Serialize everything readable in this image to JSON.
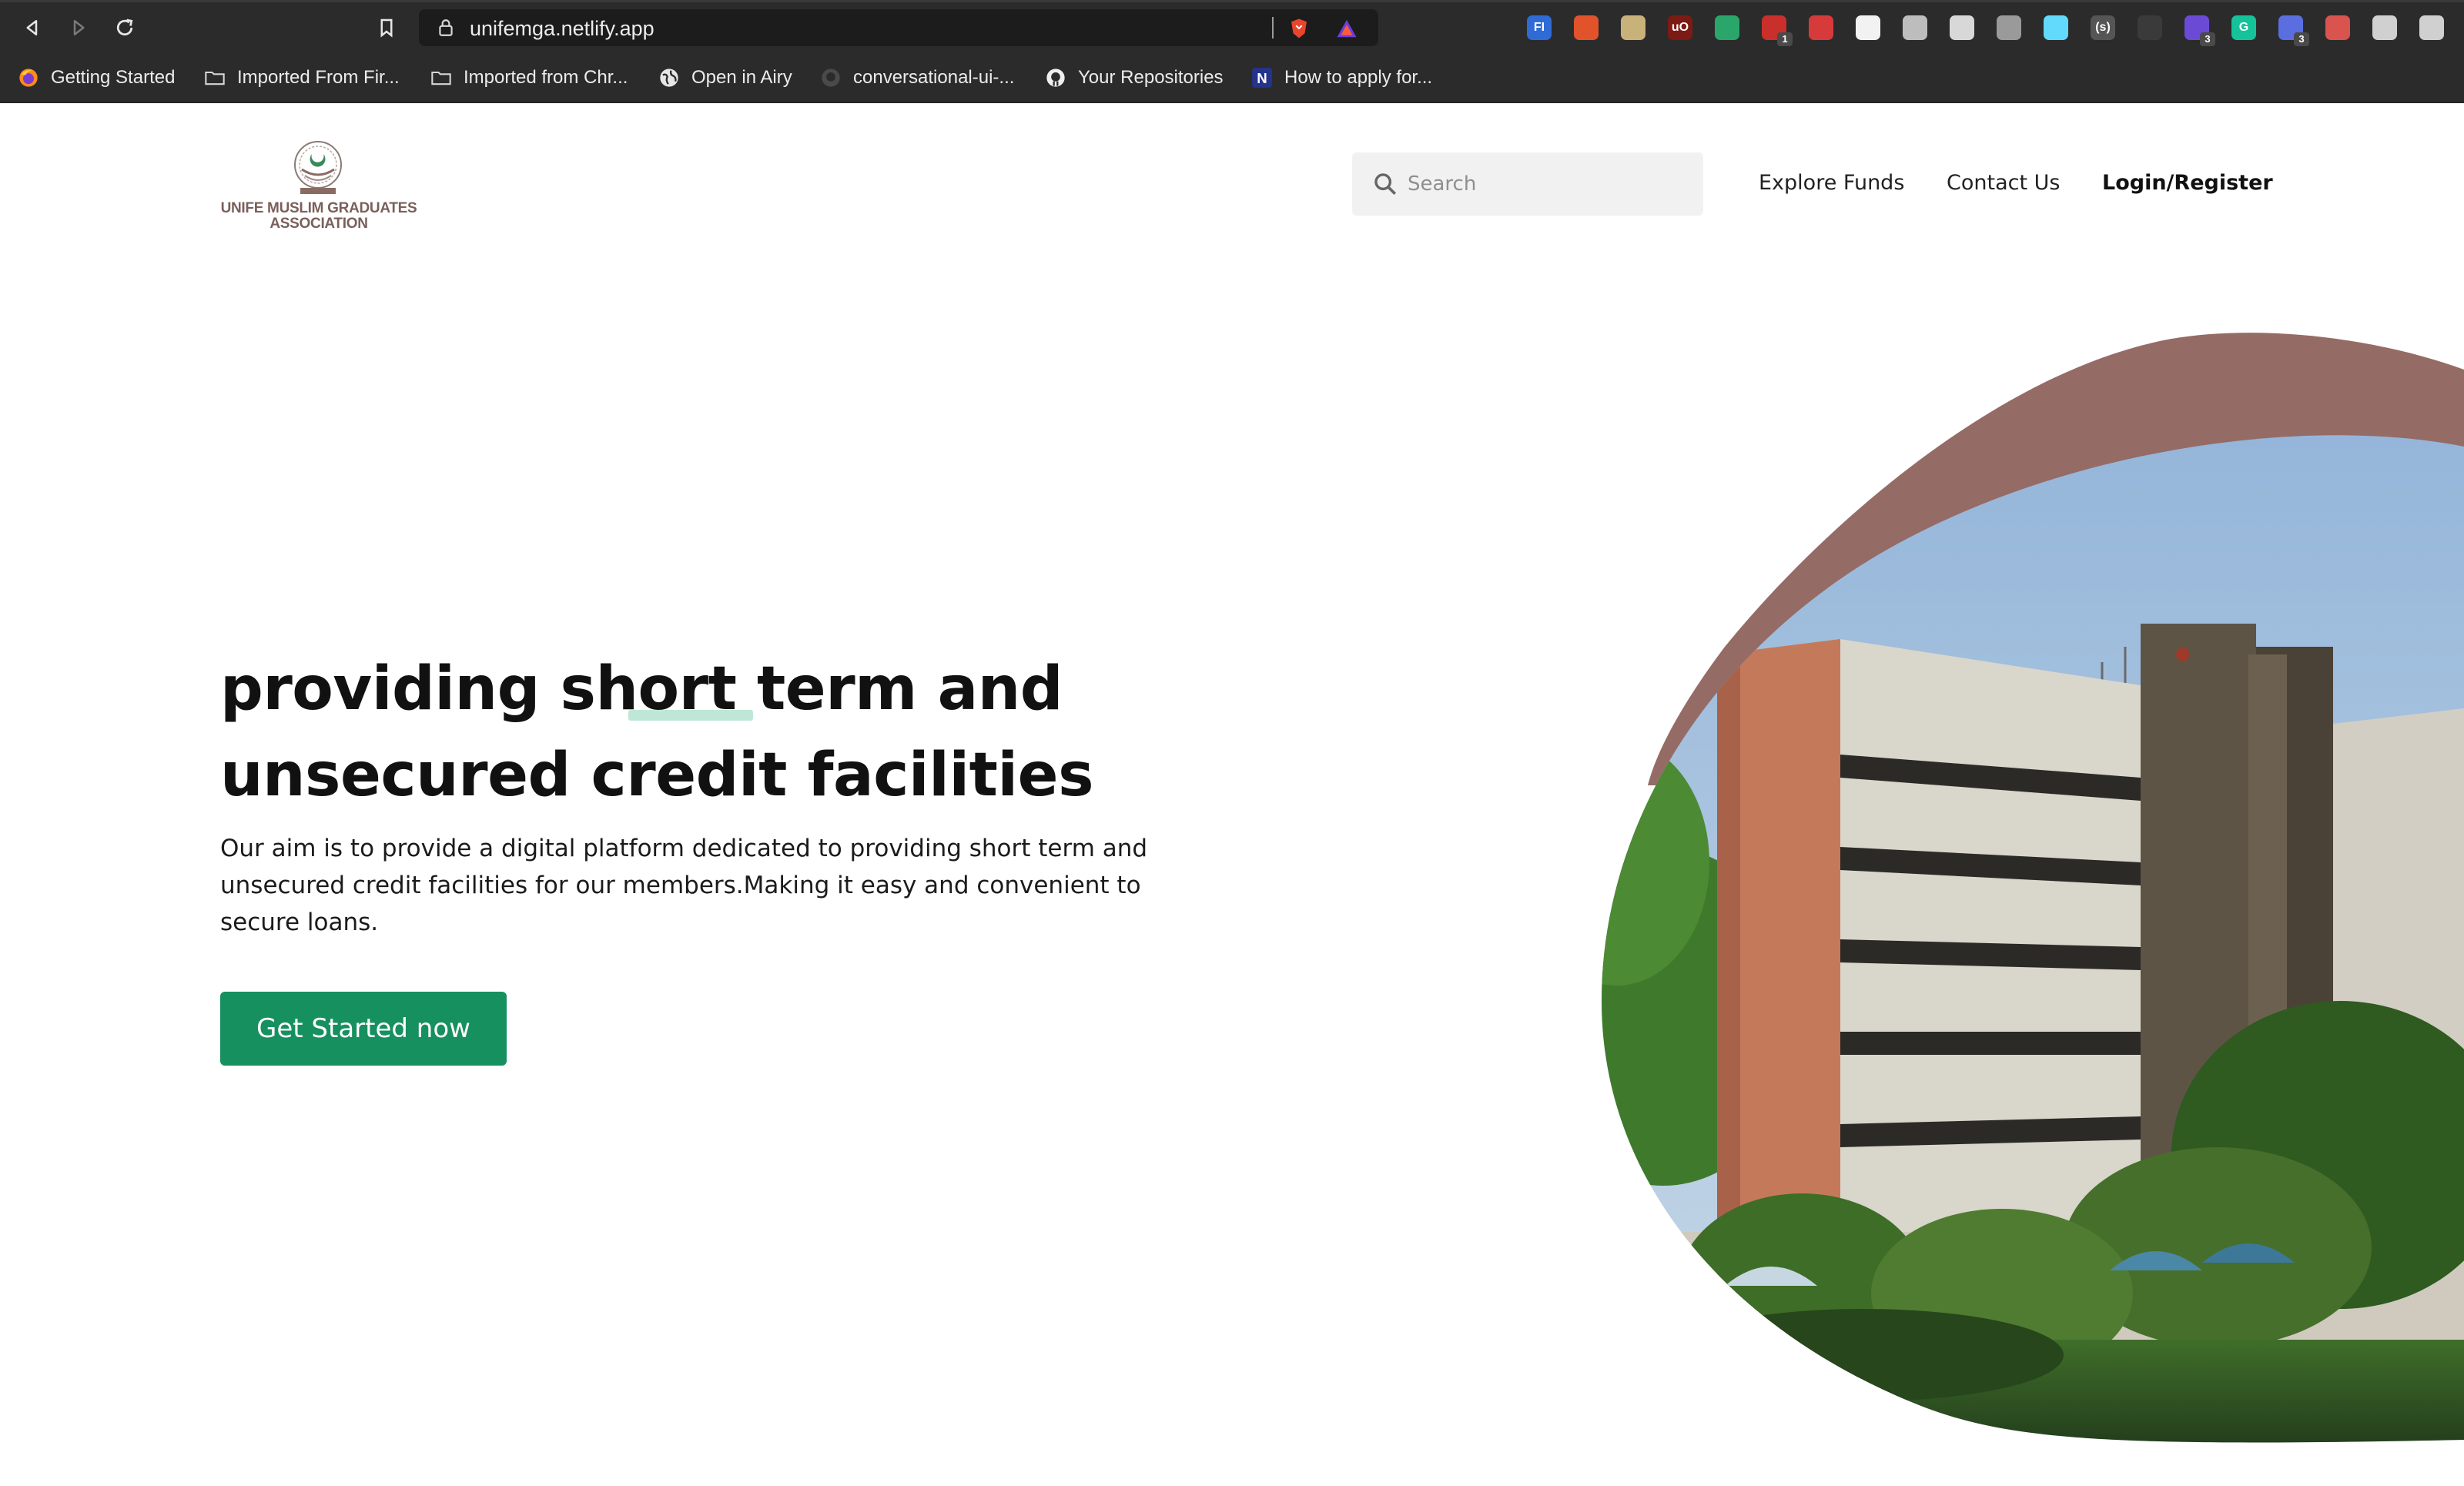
{
  "browser": {
    "url": "unifemga.netlify.app",
    "extensions": [
      {
        "name": "fl-icon",
        "label": "FI",
        "color": "#2e6bd6"
      },
      {
        "name": "flame-icon",
        "label": "",
        "color": "#e0532b"
      },
      {
        "name": "robot-icon",
        "label": "",
        "color": "#c9b27a"
      },
      {
        "name": "ublock-icon",
        "label": "uO",
        "color": "#7c1a14"
      },
      {
        "name": "globe-green-icon",
        "label": "",
        "color": "#2aa66a"
      },
      {
        "name": "todo-icon",
        "label": "",
        "color": "#c9302c",
        "badge": "1"
      },
      {
        "name": "cross-icon",
        "label": "",
        "color": "#d73a3a"
      },
      {
        "name": "mail-icon",
        "label": "",
        "color": "#f2f2f2"
      },
      {
        "name": "target-icon",
        "label": "",
        "color": "#bdbdbd"
      },
      {
        "name": "window-icon",
        "label": "",
        "color": "#d8d8d8"
      },
      {
        "name": "arc-icon",
        "label": "",
        "color": "#9a9a9a"
      },
      {
        "name": "react-icon",
        "label": "",
        "color": "#61dafb"
      },
      {
        "name": "braces-icon",
        "label": "(s)",
        "color": "#555555"
      },
      {
        "name": "shield-dark-icon",
        "label": "",
        "color": "#3a3a3a"
      },
      {
        "name": "stack-icon",
        "label": "",
        "color": "#6b4bd6",
        "badge": "3"
      },
      {
        "name": "grammarly-icon",
        "label": "G",
        "color": "#15c39a"
      },
      {
        "name": "gear-blue-icon",
        "label": "",
        "color": "#5a6ee0",
        "badge": "3"
      },
      {
        "name": "apple-icon",
        "label": "",
        "color": "#d9534f"
      },
      {
        "name": "puzzle-icon",
        "label": "",
        "color": "#d0d0d0"
      },
      {
        "name": "menu-icon",
        "label": "",
        "color": "#d0d0d0"
      }
    ],
    "bookmarks": [
      {
        "name": "bookmark-getting-started",
        "icon": "firefox-icon",
        "label": "Getting Started"
      },
      {
        "name": "bookmark-imported-firefox",
        "icon": "folder-icon",
        "label": "Imported From Fir..."
      },
      {
        "name": "bookmark-imported-chrome",
        "icon": "folder-icon",
        "label": "Imported from Chr..."
      },
      {
        "name": "bookmark-open-airy",
        "icon": "globe-icon",
        "label": "Open in Airy"
      },
      {
        "name": "bookmark-conversational-ui",
        "icon": "github-icon",
        "label": "conversational-ui-..."
      },
      {
        "name": "bookmark-your-repositories",
        "icon": "github-icon",
        "label": "Your Repositories"
      },
      {
        "name": "bookmark-how-to-apply",
        "icon": "n-icon",
        "label": "How to apply for..."
      }
    ]
  },
  "site": {
    "logo": {
      "line1": "UNIFE MUSLIM GRADUATES",
      "line2": "ASSOCIATION"
    },
    "search": {
      "placeholder": "Search"
    },
    "nav": {
      "explore": "Explore Funds",
      "contact": "Contact Us",
      "login": "Login/Register"
    },
    "hero": {
      "line1": "providing short term and",
      "line2": "unsecured credit facilities",
      "lead": "Our aim is to provide a digital platform dedicated to providing short term and unsecured credit facilities for our members.Making it easy and convenient to secure loans.",
      "cta": "Get Started now"
    },
    "colors": {
      "brand_green": "#17905f",
      "blob_mauve": "#956b66",
      "highlight": "#bfe7d8"
    }
  }
}
